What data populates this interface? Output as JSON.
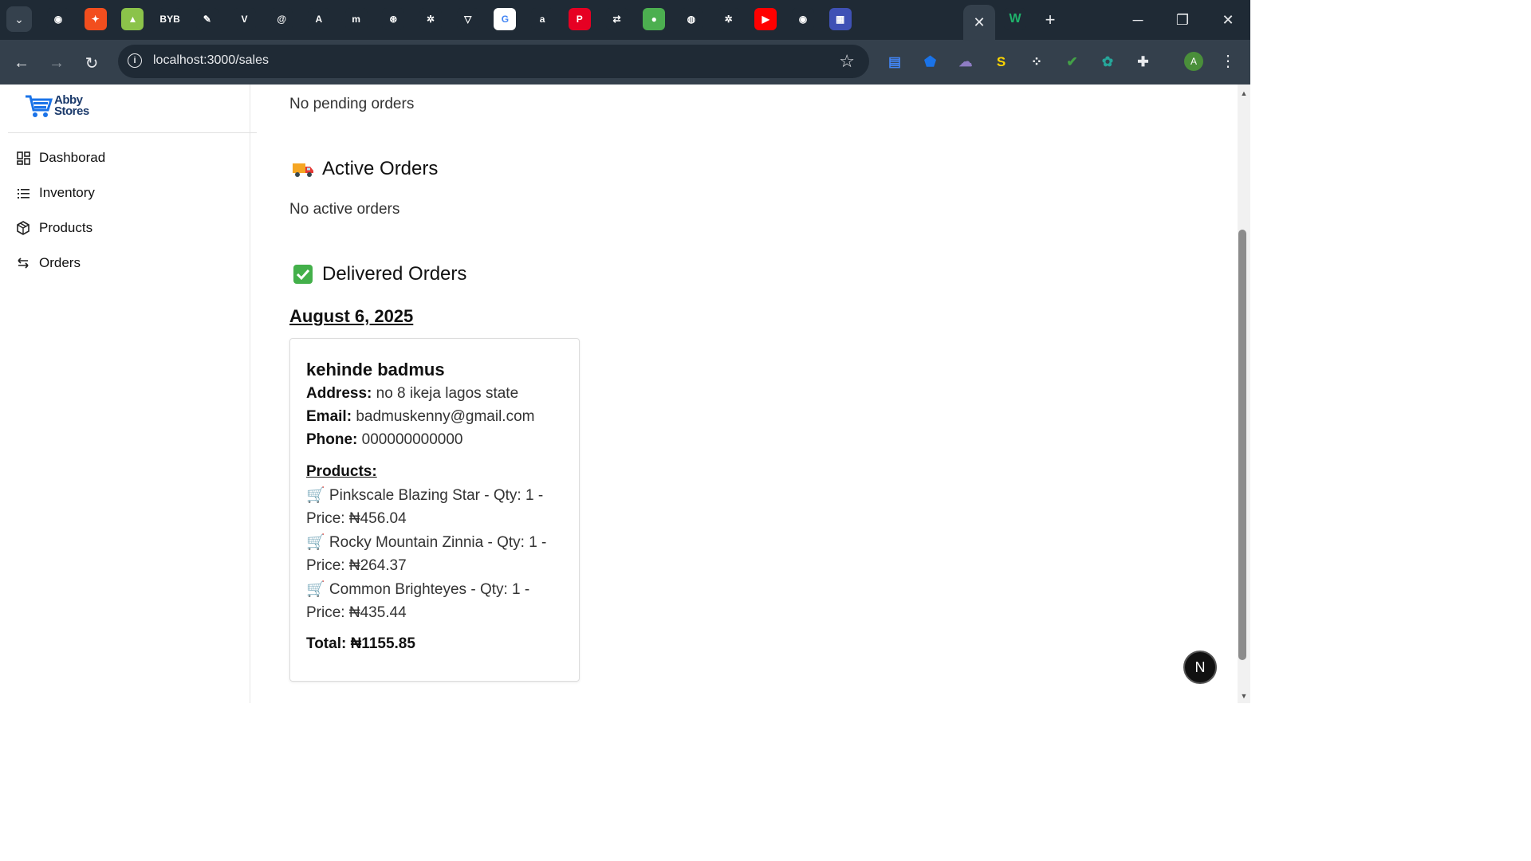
{
  "browser": {
    "url": "localhost:3000/sales",
    "active_tab_close": "✕",
    "new_tab": "+",
    "profile_initial": "A",
    "pinned_tabs": [
      {
        "icon": "github-icon",
        "glyph": "◉",
        "color": "#1f2a35"
      },
      {
        "icon": "figma-icon",
        "glyph": "✦",
        "color": "#f24e1e"
      },
      {
        "icon": "chart-icon",
        "glyph": "▲",
        "color": "#8bc34a"
      },
      {
        "icon": "bybit-icon",
        "glyph": "BYB",
        "color": "#1f2a35"
      },
      {
        "icon": "pen-icon",
        "glyph": "✎",
        "color": "#1f2a35"
      },
      {
        "icon": "vercel-icon",
        "glyph": "V",
        "color": "#1f2a35"
      },
      {
        "icon": "swirl-icon",
        "glyph": "@",
        "color": "#1f2a35"
      },
      {
        "icon": "a-logo-icon",
        "glyph": "A",
        "color": "#1f2a35"
      },
      {
        "icon": "m-logo-icon",
        "glyph": "m",
        "color": "#1f2a35"
      },
      {
        "icon": "circle-logo-icon",
        "glyph": "⊛",
        "color": "#1f2a35"
      },
      {
        "icon": "openai-icon",
        "glyph": "✲",
        "color": "#1f2a35"
      },
      {
        "icon": "prisma-icon",
        "glyph": "▽",
        "color": "#1f2a35"
      },
      {
        "icon": "google-icon",
        "glyph": "G",
        "color": "#ffffff"
      },
      {
        "icon": "tool-icon",
        "glyph": "a",
        "color": "#1f2a35"
      },
      {
        "icon": "pinterest-icon",
        "glyph": "P",
        "color": "#e60023"
      },
      {
        "icon": "link-icon",
        "glyph": "⇄",
        "color": "#1f2a35"
      },
      {
        "icon": "green-circle-icon",
        "glyph": "●",
        "color": "#4caf50"
      },
      {
        "icon": "globe-icon",
        "glyph": "◍",
        "color": "#1f2a35"
      },
      {
        "icon": "chatgpt-icon",
        "glyph": "✲",
        "color": "#1f2a35"
      },
      {
        "icon": "youtube-icon",
        "glyph": "▶",
        "color": "#ff0000"
      },
      {
        "icon": "github-icon",
        "glyph": "◉",
        "color": "#1f2a35"
      },
      {
        "icon": "dashboard-icon",
        "glyph": "▦",
        "color": "#3f51b5"
      }
    ],
    "extensions": [
      {
        "icon": "docs-icon",
        "glyph": "▤",
        "color": "#4285f4"
      },
      {
        "icon": "shield-icon",
        "glyph": "⬟",
        "color": "#1a73e8"
      },
      {
        "icon": "ghost-icon",
        "glyph": "☁",
        "color": "#8e7cc3"
      },
      {
        "icon": "s-extension-icon",
        "glyph": "S",
        "color": "#ffd600"
      },
      {
        "icon": "grid-icon",
        "glyph": "⁘",
        "color": "#ffffff"
      },
      {
        "icon": "vpn-icon",
        "glyph": "✔",
        "color": "#43a047"
      },
      {
        "icon": "brush-icon",
        "glyph": "✿",
        "color": "#26a69a"
      },
      {
        "icon": "puzzle-icon",
        "glyph": "✚",
        "color": "#e8eaed"
      }
    ]
  },
  "sidebar": {
    "logo_line1": "Abby",
    "logo_line2": "Stores",
    "items": [
      {
        "label": "Dashborad",
        "icon": "dashboard-grid-icon"
      },
      {
        "label": "Inventory",
        "icon": "list-icon"
      },
      {
        "label": "Products",
        "icon": "package-icon"
      },
      {
        "label": "Orders",
        "icon": "swap-arrows-icon"
      }
    ]
  },
  "main": {
    "pending_empty": "No pending orders",
    "active_title": "Active Orders",
    "active_empty": "No active orders",
    "delivered_title": "Delivered Orders",
    "date_heading": "August 6, 2025",
    "order": {
      "customer": "kehinde badmus",
      "address_label": "Address:",
      "address": "no 8 ikeja lagos state",
      "email_label": "Email:",
      "email": "badmuskenny@gmail.com",
      "phone_label": "Phone:",
      "phone": "000000000000",
      "products_label": "Products:",
      "products": [
        {
          "text": "🛒 Pinkscale Blazing Star - Qty: 1 - Price: ₦456.04"
        },
        {
          "text": "🛒 Rocky Mountain Zinnia - Qty: 1 - Price: ₦264.37"
        },
        {
          "text": "🛒 Common Brighteyes - Qty: 1 - Price: ₦435.44"
        }
      ],
      "total": "Total: ₦1155.85"
    }
  },
  "dev_badge": "N"
}
